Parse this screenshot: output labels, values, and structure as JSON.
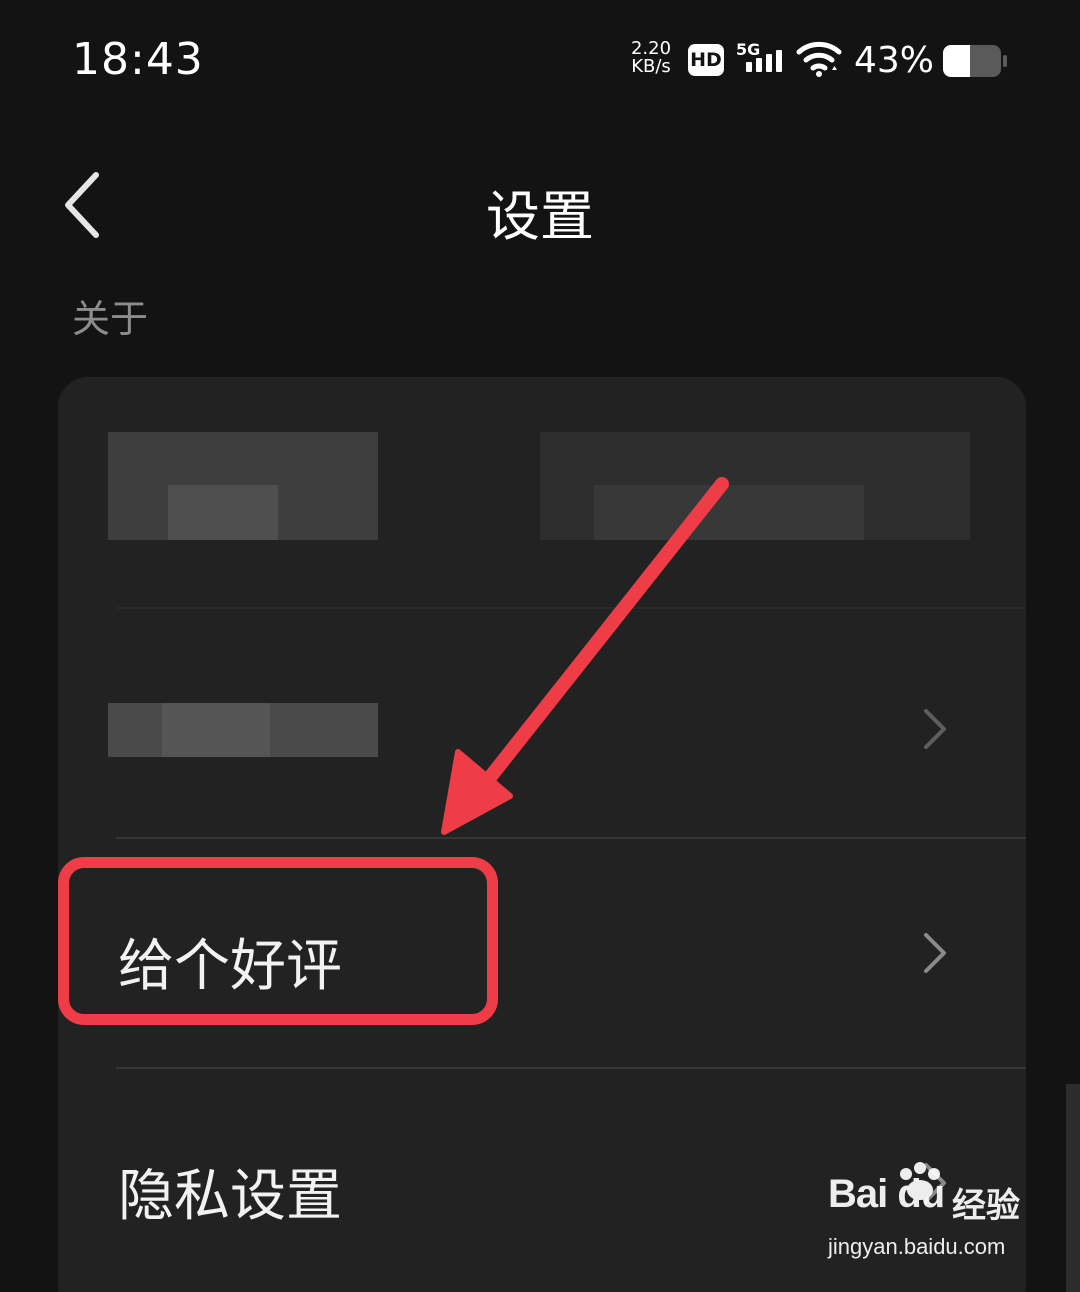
{
  "status_bar": {
    "time": "18:43",
    "net_speed_value": "2.20",
    "net_speed_unit": "KB/s",
    "hd_label": "HD",
    "network_type": "5G",
    "battery_percent": "43%",
    "battery_level": 0.43
  },
  "header": {
    "title": "设置",
    "back_icon": "chevron-left-icon"
  },
  "section": {
    "label": "关于"
  },
  "list": {
    "items": [
      {
        "label": "",
        "redacted": true
      },
      {
        "label": "",
        "redacted": true
      },
      {
        "label": "给个好评",
        "highlighted": true
      },
      {
        "label": "隐私设置"
      }
    ]
  },
  "colors": {
    "background": "#131313",
    "card": "#222222",
    "highlight": "#ef3d47",
    "text_primary": "#f2f2f2",
    "text_secondary": "#8d8d8d"
  },
  "watermark": {
    "logo": "Bai du",
    "cn": "经验",
    "url": "jingyan.baidu.com"
  }
}
